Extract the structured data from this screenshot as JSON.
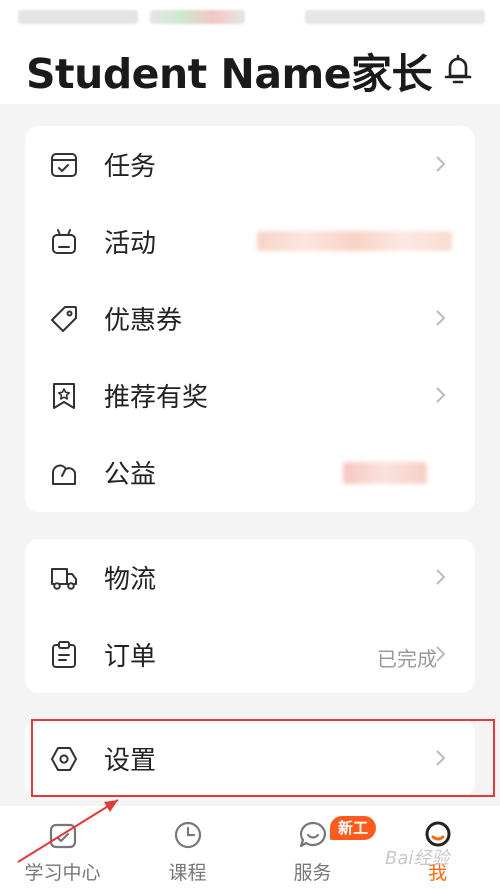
{
  "header": {
    "title": "Student Name家长",
    "bell_icon": "bell-icon"
  },
  "section1": {
    "items": [
      {
        "label": "任务",
        "icon": "task-icon",
        "chevron": true
      },
      {
        "label": "活动",
        "icon": "activity-icon",
        "chevron": false
      },
      {
        "label": "优惠券",
        "icon": "coupon-icon",
        "chevron": true
      },
      {
        "label": "推荐有奖",
        "icon": "referral-icon",
        "chevron": true
      },
      {
        "label": "公益",
        "icon": "charity-icon",
        "chevron": false
      }
    ]
  },
  "section2": {
    "items": [
      {
        "label": "物流",
        "icon": "truck-icon",
        "chevron": true
      },
      {
        "label": "订单",
        "icon": "order-icon",
        "value": "已完成",
        "chevron": true
      }
    ]
  },
  "section3": {
    "items": [
      {
        "label": "设置",
        "icon": "settings-icon",
        "chevron": true
      }
    ]
  },
  "tabbar": {
    "tabs": [
      {
        "label": "学习中心",
        "icon": "study-center-icon"
      },
      {
        "label": "课程",
        "icon": "clock-icon"
      },
      {
        "label": "服务",
        "icon": "chat-smile-icon",
        "badge": "新工"
      },
      {
        "label": "我",
        "icon": "profile-icon",
        "active": true
      }
    ]
  },
  "watermark": "Bai经验",
  "colors": {
    "accent": "#ff6a13",
    "badge": "#ff5b1f",
    "highlight": "#e23a3a"
  }
}
